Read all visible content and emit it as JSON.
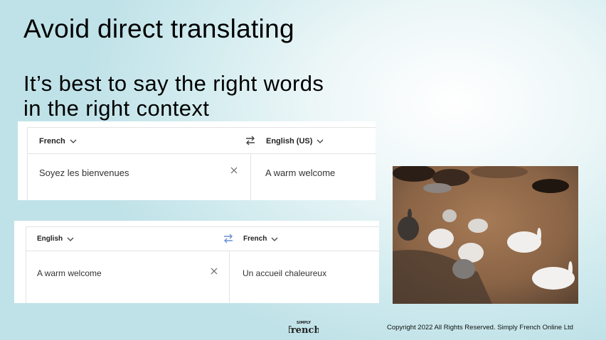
{
  "slide": {
    "title": "Avoid direct translating",
    "subtitle": "It’s best to say the right words in the right context",
    "copyright": "Copyright 2022 All Rights Reserved. Simply French Online Ltd"
  },
  "translator1": {
    "source_lang": "French",
    "target_lang": "English (US)",
    "source_text": "Soyez les bienvenues",
    "target_text": "A warm welcome"
  },
  "translator2": {
    "source_lang": "English",
    "target_lang": "French",
    "source_text": "A warm welcome",
    "target_text": "Un accueil chaleureux"
  },
  "logo": {
    "top": "SIMPLY",
    "main": "french"
  },
  "icons": {
    "swap": "swap-arrows-icon",
    "clear": "close-icon",
    "dropdown": "chevron-down-icon"
  },
  "colors": {
    "swap_icon_2": "#6a8fd6"
  }
}
